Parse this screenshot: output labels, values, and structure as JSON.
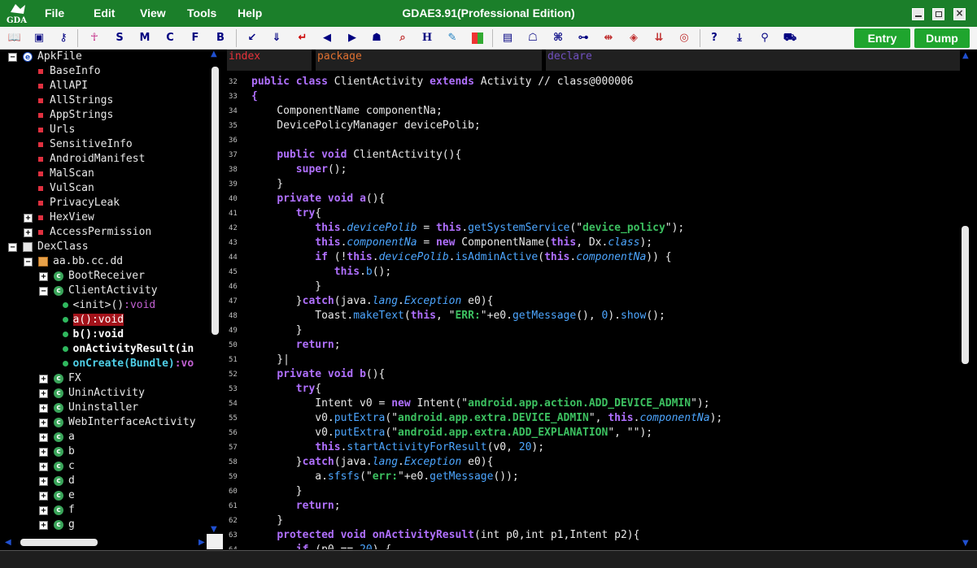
{
  "app": {
    "title": "GDAE3.91(Professional Edition)",
    "logo_text": "GDA"
  },
  "menu": [
    "File",
    "Edit",
    "View",
    "Tools",
    "Help"
  ],
  "toolbar": {
    "letters": [
      "S",
      "M",
      "C",
      "F",
      "B"
    ],
    "h_label": "H",
    "entry_label": "Entry",
    "dump_label": "Dump"
  },
  "tree": [
    {
      "label": "ApkFile",
      "indent": 0,
      "exp": "−",
      "icon": "globe"
    },
    {
      "label": "BaseInfo",
      "indent": 2,
      "icon": "sq"
    },
    {
      "label": "AllAPI",
      "indent": 2,
      "icon": "sq"
    },
    {
      "label": "AllStrings",
      "indent": 2,
      "icon": "sq"
    },
    {
      "label": "AppStrings",
      "indent": 2,
      "icon": "sq"
    },
    {
      "label": "Urls",
      "indent": 2,
      "icon": "sq"
    },
    {
      "label": "SensitiveInfo",
      "indent": 2,
      "icon": "sq"
    },
    {
      "label": "AndroidManifest",
      "indent": 2,
      "icon": "sq"
    },
    {
      "label": "MalScan",
      "indent": 2,
      "icon": "sq"
    },
    {
      "label": "VulScan",
      "indent": 2,
      "icon": "sq"
    },
    {
      "label": "PrivacyLeak",
      "indent": 2,
      "icon": "sq"
    },
    {
      "label": "HexView",
      "indent": 2,
      "exp": "+",
      "icon": "sq"
    },
    {
      "label": "AccessPermission",
      "indent": 2,
      "exp": "+",
      "icon": "sq"
    },
    {
      "label": "DexClass",
      "indent": 0,
      "exp": "−",
      "icon": "dex"
    },
    {
      "label": "aa.bb.cc.dd",
      "indent": 2,
      "exp": "−",
      "icon": "pkg"
    },
    {
      "label": "BootReceiver",
      "indent": 4,
      "exp": "+",
      "icon": "cls"
    },
    {
      "label": "ClientActivity",
      "indent": 4,
      "exp": "−",
      "icon": "cls"
    },
    {
      "label": "<init>():void",
      "indent": 7,
      "icon": "m",
      "style": "init"
    },
    {
      "label": "a():void",
      "indent": 7,
      "icon": "m",
      "style": "sel"
    },
    {
      "label": "b():void",
      "indent": 7,
      "icon": "m",
      "style": "bold"
    },
    {
      "label": "onActivityResult(in",
      "indent": 7,
      "icon": "m",
      "style": "bold"
    },
    {
      "label": "onCreate(Bundle):vo",
      "indent": 7,
      "icon": "m",
      "style": "cyan"
    },
    {
      "label": "FX",
      "indent": 4,
      "exp": "+",
      "icon": "cls"
    },
    {
      "label": "UninActivity",
      "indent": 4,
      "exp": "+",
      "icon": "cls"
    },
    {
      "label": "Uninstaller",
      "indent": 4,
      "exp": "+",
      "icon": "cls"
    },
    {
      "label": "WebInterfaceActivity",
      "indent": 4,
      "exp": "+",
      "icon": "cls"
    },
    {
      "label": "a",
      "indent": 4,
      "exp": "+",
      "icon": "cls"
    },
    {
      "label": "b",
      "indent": 4,
      "exp": "+",
      "icon": "cls"
    },
    {
      "label": "c",
      "indent": 4,
      "exp": "+",
      "icon": "cls"
    },
    {
      "label": "d",
      "indent": 4,
      "exp": "+",
      "icon": "cls"
    },
    {
      "label": "e",
      "indent": 4,
      "exp": "+",
      "icon": "cls"
    },
    {
      "label": "f",
      "indent": 4,
      "exp": "+",
      "icon": "cls"
    },
    {
      "label": "g",
      "indent": 4,
      "exp": "+",
      "icon": "cls"
    }
  ],
  "editor": {
    "headers": [
      {
        "label": "index",
        "color": "#e8323a"
      },
      {
        "label": "package",
        "color": "#e07030"
      },
      {
        "label": "declare",
        "color": "#7050c0"
      }
    ],
    "lines": [
      {
        "n": "32",
        "html": "<span class='k'>public class</span> ClientActivity <span class='k'>extends</span> Activity // class@000006"
      },
      {
        "n": "33",
        "html": "<span class='k'>{</span>"
      },
      {
        "n": "34",
        "html": "    ComponentName componentNa;"
      },
      {
        "n": "35",
        "html": "    DevicePolicyManager devicePolib;"
      },
      {
        "n": "36",
        "html": ""
      },
      {
        "n": "37",
        "html": "    <span class='k'>public void</span> ClientActivity(){"
      },
      {
        "n": "38",
        "html": "       <span class='k'>super</span>();"
      },
      {
        "n": "39",
        "html": "    }"
      },
      {
        "n": "40",
        "html": "    <span class='k'>private void</span> <span class='k'>a</span>(){"
      },
      {
        "n": "41",
        "html": "       <span class='k'>try</span>{"
      },
      {
        "n": "42",
        "html": "          <span class='k'>this</span>.<span class='i'>devicePolib</span> = <span class='k'>this</span>.<span class='f'>getSystemService</span>(\"<span class='s'>device_policy</span>\");"
      },
      {
        "n": "43",
        "html": "          <span class='k'>this</span>.<span class='i'>componentNa</span> = <span class='k'>new</span> ComponentName(<span class='k'>this</span>, Dx.<span class='i'>class</span>);"
      },
      {
        "n": "44",
        "html": "          <span class='k'>if</span> (!<span class='k'>this</span>.<span class='i'>devicePolib</span>.<span class='f'>isAdminActive</span>(<span class='k'>this</span>.<span class='i'>componentNa</span>)) {"
      },
      {
        "n": "45",
        "html": "             <span class='k'>this</span>.<span class='f'>b</span>();"
      },
      {
        "n": "46",
        "html": "          }"
      },
      {
        "n": "47",
        "html": "       }<span class='k'>catch</span>(java.<span class='i'>lang</span>.<span class='i'>Exception</span> e0){"
      },
      {
        "n": "48",
        "html": "          Toast.<span class='f'>makeText</span>(<span class='k'>this</span>, \"<span class='s'>ERR:</span>\"+e0.<span class='f'>getMessage</span>(), <span class='n'>0</span>).<span class='f'>show</span>();"
      },
      {
        "n": "49",
        "html": "       }"
      },
      {
        "n": "50",
        "html": "       <span class='k'>return</span>;"
      },
      {
        "n": "51",
        "html": "    }|"
      },
      {
        "n": "52",
        "html": "    <span class='k'>private void</span> <span class='k'>b</span>(){"
      },
      {
        "n": "53",
        "html": "       <span class='k'>try</span>{"
      },
      {
        "n": "54",
        "html": "          Intent v0 = <span class='k'>new</span> Intent(\"<span class='s'>android.app.action.ADD_DEVICE_ADMIN</span>\");"
      },
      {
        "n": "55",
        "html": "          v0.<span class='f'>putExtra</span>(\"<span class='s'>android.app.extra.DEVICE_ADMIN</span>\", <span class='k'>this</span>.<span class='i'>componentNa</span>);"
      },
      {
        "n": "56",
        "html": "          v0.<span class='f'>putExtra</span>(\"<span class='s'>android.app.extra.ADD_EXPLANATION</span>\", \"\");"
      },
      {
        "n": "57",
        "html": "          <span class='k'>this</span>.<span class='f'>startActivityForResult</span>(v0, <span class='n'>20</span>);"
      },
      {
        "n": "58",
        "html": "       }<span class='k'>catch</span>(java.<span class='i'>lang</span>.<span class='i'>Exception</span> e0){"
      },
      {
        "n": "59",
        "html": "          a.<span class='f'>sfsfs</span>(\"<span class='s'>err:</span>\"+e0.<span class='f'>getMessage</span>());"
      },
      {
        "n": "60",
        "html": "       }"
      },
      {
        "n": "61",
        "html": "       <span class='k'>return</span>;"
      },
      {
        "n": "62",
        "html": "    }"
      },
      {
        "n": "63",
        "html": "    <span class='k'>protected void</span> <span class='k'>onActivityResult</span>(int p0,int p1,Intent p2){"
      },
      {
        "n": "64",
        "html": "       <span class='k'>if</span> (p0 == <span class='n'>20</span>) {"
      }
    ]
  }
}
